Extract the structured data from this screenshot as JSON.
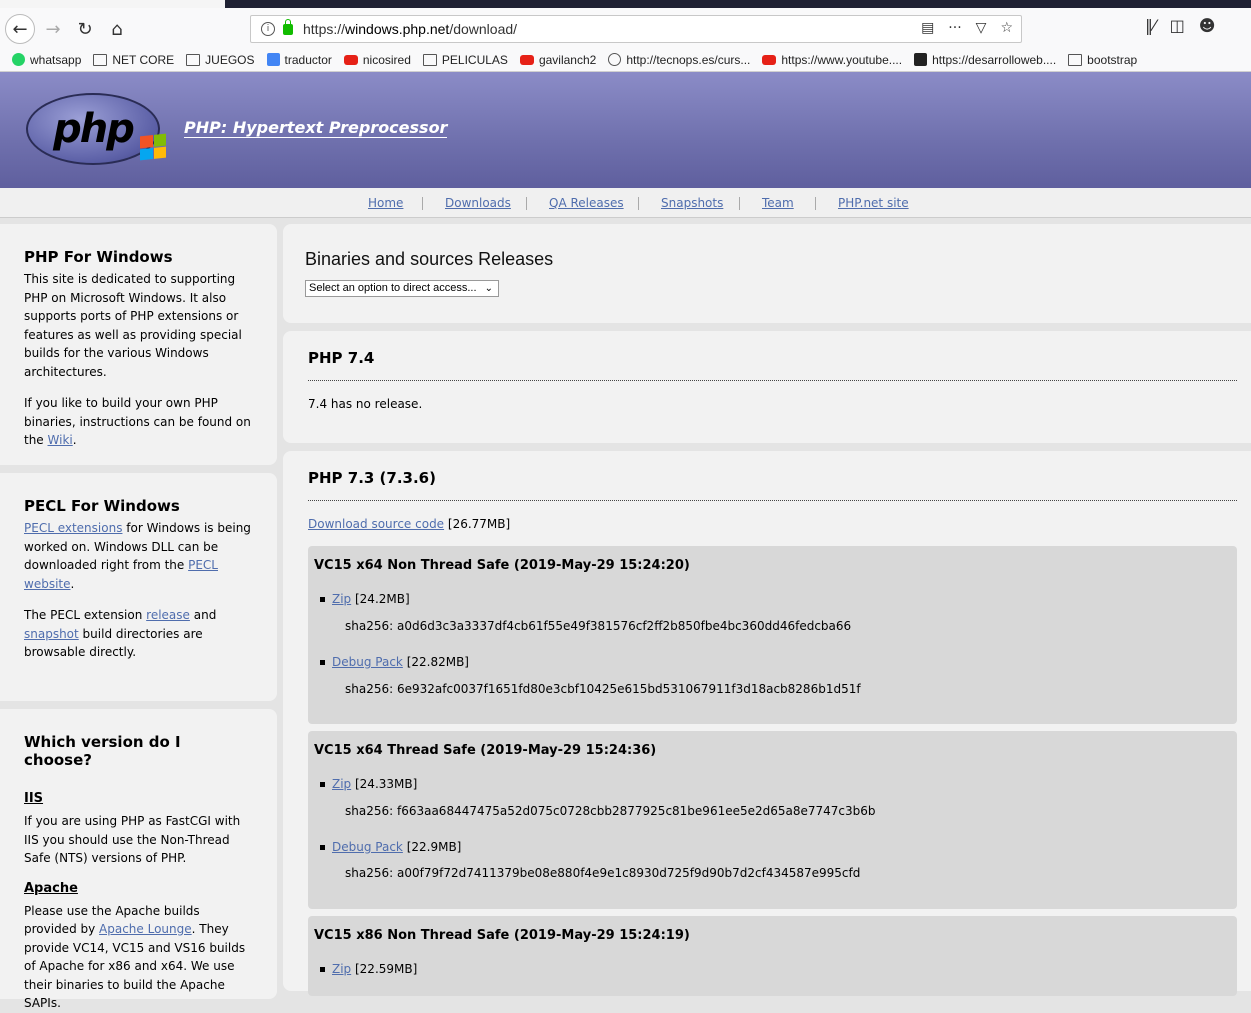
{
  "browser": {
    "url_prefix": "https://",
    "url_host": "windows.php.net",
    "url_path": "/download/",
    "bookmarks": [
      {
        "label": "whatsapp",
        "icon": "whatsapp-icon"
      },
      {
        "label": "NET CORE",
        "icon": "folder-icon"
      },
      {
        "label": "JUEGOS",
        "icon": "folder-icon"
      },
      {
        "label": "traductor",
        "icon": "translate-icon"
      },
      {
        "label": "nicosired",
        "icon": "youtube-icon"
      },
      {
        "label": "PELICULAS",
        "icon": "folder-icon"
      },
      {
        "label": "gavilanch2",
        "icon": "youtube-icon"
      },
      {
        "label": "http://tecnops.es/curs...",
        "icon": "globe-icon"
      },
      {
        "label": "https://www.youtube....",
        "icon": "youtube-icon"
      },
      {
        "label": "https://desarrolloweb....",
        "icon": "dev-icon"
      },
      {
        "label": "bootstrap",
        "icon": "folder-icon"
      }
    ]
  },
  "header": {
    "logo_text": "php",
    "title": "PHP: Hypertext Preprocessor"
  },
  "nav": [
    "Home",
    "Downloads",
    "QA Releases",
    "Snapshots",
    "Team",
    "PHP.net site"
  ],
  "sidebar": {
    "windows": {
      "title": "PHP For Windows",
      "p1": "This site is dedicated to supporting PHP on Microsoft Windows. It also supports ports of PHP extensions or features as well as providing special builds for the various Windows architectures.",
      "p2_pre": "If you like to build your own PHP binaries, instructions can be found on the ",
      "p2_link": "Wiki",
      "p2_post": "."
    },
    "pecl": {
      "title": "PECL For Windows",
      "p1_link1": "PECL extensions",
      "p1_mid": " for Windows is being worked on. Windows DLL can be downloaded right from the ",
      "p1_link2": "PECL website",
      "p1_post": ".",
      "p2_pre": "The PECL extension ",
      "p2_link1": "release",
      "p2_mid": " and ",
      "p2_link2": "snapshot",
      "p2_post": " build directories are browsable directly."
    },
    "choose": {
      "title": "Which version do I choose?",
      "iis_title": "IIS",
      "iis_text": "If you are using PHP as FastCGI with IIS you should use the Non-Thread Safe (NTS) versions of PHP.",
      "apache_title": "Apache",
      "apache_pre": "Please use the Apache builds provided by ",
      "apache_link": "Apache Lounge",
      "apache_post": ". They provide VC14, VC15 and VS16 builds of Apache for x86 and x64. We use their binaries to build the Apache SAPIs."
    }
  },
  "main": {
    "title": "Binaries and sources Releases",
    "select_placeholder": "Select an option to direct access...",
    "php74": {
      "title": "PHP 7.4",
      "text": "7.4 has no release."
    },
    "php73": {
      "title": "PHP 7.3 (7.3.6)",
      "source_link": "Download source code",
      "source_size": " [26.77MB]",
      "builds": [
        {
          "title": "VC15 x64 Non Thread Safe (2019-May-29 15:24:20)",
          "zip_label": "Zip",
          "zip_size": " [24.2MB]",
          "zip_sha": "sha256: a0d6d3c3a3337df4cb61f55e49f381576cf2ff2b850fbe4bc360dd46fedcba66",
          "debug_label": "Debug Pack",
          "debug_size": " [22.82MB]",
          "debug_sha": "sha256: 6e932afc0037f1651fd80e3cbf10425e615bd531067911f3d18acb8286b1d51f"
        },
        {
          "title": "VC15 x64 Thread Safe (2019-May-29 15:24:36)",
          "zip_label": "Zip",
          "zip_size": " [24.33MB]",
          "zip_sha": "sha256: f663aa68447475a52d075c0728cbb2877925c81be961ee5e2d65a8e7747c3b6b",
          "debug_label": "Debug Pack",
          "debug_size": " [22.9MB]",
          "debug_sha": "sha256: a00f79f72d7411379be08e880f4e9e1c8930d725f9d90b7d2cf434587e995cfd"
        },
        {
          "title": "VC15 x86 Non Thread Safe (2019-May-29 15:24:19)",
          "zip_label": "Zip",
          "zip_size": " [22.59MB]"
        }
      ]
    }
  }
}
